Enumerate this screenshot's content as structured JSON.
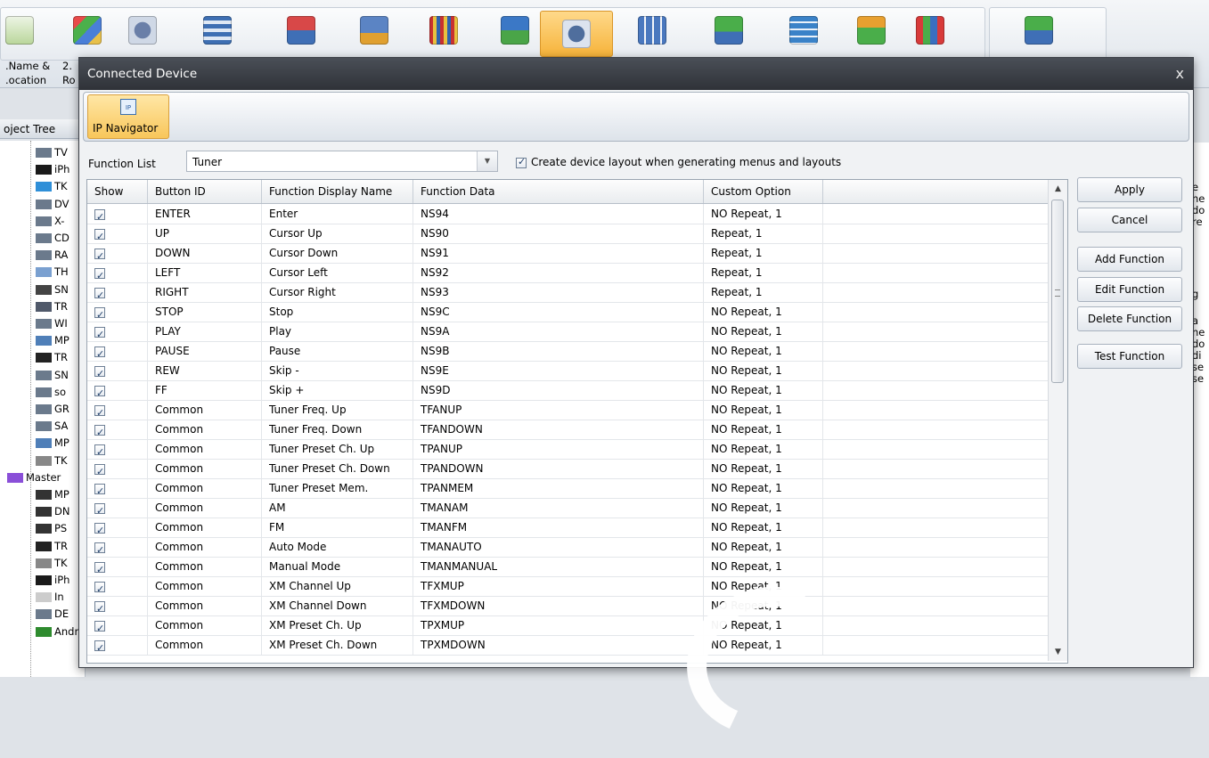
{
  "app": {
    "left_labels": [
      ".Name &",
      ".ocation"
    ],
    "left_labels2": [
      "2.",
      "Ro"
    ],
    "project_tree_header": "oject Tree",
    "tree_items": [
      "TV",
      "iPh",
      "TK",
      "DV",
      "X-",
      "CD",
      "RA",
      "TH",
      "SN",
      "TR",
      "WI",
      "MP",
      "TR",
      "SN",
      "so",
      "GR",
      "SA",
      "MP",
      "TK",
      "Master",
      "MP",
      "DN",
      "PS",
      "TR",
      "TK",
      "iPh",
      "In",
      "DE",
      "Android Phone"
    ],
    "right_pane_text": [
      "re",
      "im",
      "um",
      "e",
      "ne",
      "do",
      "re",
      "g",
      "a",
      "ne",
      "do",
      "di",
      "se",
      "se"
    ]
  },
  "dialog": {
    "title": "Connected Device",
    "close_label": "x",
    "ribbon_button_label": "IP Navigator",
    "ribbon_icon_text": "IP",
    "function_list_label": "Function List",
    "function_list_value": "Tuner",
    "create_layout_label": "Create device layout when generating menus and layouts",
    "columns": [
      "Show",
      "Button ID",
      "Function Display Name",
      "Function Data",
      "Custom Option"
    ],
    "rows": [
      {
        "show": true,
        "button_id": "ENTER",
        "name": "Enter",
        "data": "NS94",
        "option": "NO Repeat, 1"
      },
      {
        "show": true,
        "button_id": "UP",
        "name": "Cursor Up",
        "data": "NS90",
        "option": "Repeat, 1"
      },
      {
        "show": true,
        "button_id": "DOWN",
        "name": "Cursor Down",
        "data": "NS91",
        "option": "Repeat, 1"
      },
      {
        "show": true,
        "button_id": "LEFT",
        "name": "Cursor Left",
        "data": "NS92",
        "option": "Repeat, 1"
      },
      {
        "show": true,
        "button_id": "RIGHT",
        "name": "Cursor Right",
        "data": "NS93",
        "option": "Repeat, 1"
      },
      {
        "show": true,
        "button_id": "STOP",
        "name": "Stop",
        "data": "NS9C",
        "option": "NO Repeat, 1"
      },
      {
        "show": true,
        "button_id": "PLAY",
        "name": "Play",
        "data": "NS9A",
        "option": "NO Repeat, 1"
      },
      {
        "show": true,
        "button_id": "PAUSE",
        "name": "Pause",
        "data": "NS9B",
        "option": "NO Repeat, 1"
      },
      {
        "show": true,
        "button_id": "REW",
        "name": "Skip -",
        "data": "NS9E",
        "option": "NO Repeat, 1"
      },
      {
        "show": true,
        "button_id": "FF",
        "name": "Skip +",
        "data": "NS9D",
        "option": "NO Repeat, 1"
      },
      {
        "show": true,
        "button_id": "Common",
        "name": "Tuner Freq. Up",
        "data": "TFANUP",
        "option": "NO Repeat, 1"
      },
      {
        "show": true,
        "button_id": "Common",
        "name": "Tuner Freq. Down",
        "data": "TFANDOWN",
        "option": "NO Repeat, 1"
      },
      {
        "show": true,
        "button_id": "Common",
        "name": "Tuner Preset Ch. Up",
        "data": "TPANUP",
        "option": "NO Repeat, 1"
      },
      {
        "show": true,
        "button_id": "Common",
        "name": "Tuner Preset Ch. Down",
        "data": "TPANDOWN",
        "option": "NO Repeat, 1"
      },
      {
        "show": true,
        "button_id": "Common",
        "name": "Tuner Preset Mem.",
        "data": "TPANMEM",
        "option": "NO Repeat, 1"
      },
      {
        "show": true,
        "button_id": "Common",
        "name": "AM",
        "data": "TMANAM",
        "option": "NO Repeat, 1"
      },
      {
        "show": true,
        "button_id": "Common",
        "name": "FM",
        "data": "TMANFM",
        "option": "NO Repeat, 1"
      },
      {
        "show": true,
        "button_id": "Common",
        "name": "Auto Mode",
        "data": "TMANAUTO",
        "option": "NO Repeat, 1"
      },
      {
        "show": true,
        "button_id": "Common",
        "name": "Manual Mode",
        "data": "TMANMANUAL",
        "option": "NO Repeat, 1"
      },
      {
        "show": true,
        "button_id": "Common",
        "name": "XM Channel Up",
        "data": "TFXMUP",
        "option": "NO Repeat, 1"
      },
      {
        "show": true,
        "button_id": "Common",
        "name": "XM Channel Down",
        "data": "TFXMDOWN",
        "option": "NO Repeat, 1"
      },
      {
        "show": true,
        "button_id": "Common",
        "name": "XM Preset Ch. Up",
        "data": "TPXMUP",
        "option": "NO Repeat, 1"
      },
      {
        "show": true,
        "button_id": "Common",
        "name": "XM Preset Ch. Down",
        "data": "TPXMDOWN",
        "option": "NO Repeat, 1"
      }
    ],
    "buttons": {
      "apply": "Apply",
      "cancel": "Cancel",
      "add": "Add Function",
      "edit": "Edit Function",
      "delete": "Delete Function",
      "test": "Test Function"
    }
  },
  "colors": {
    "active_ribbon": "#f8c65a",
    "titlebar": "#2f3238",
    "checkbox_mark": "#21406b"
  }
}
